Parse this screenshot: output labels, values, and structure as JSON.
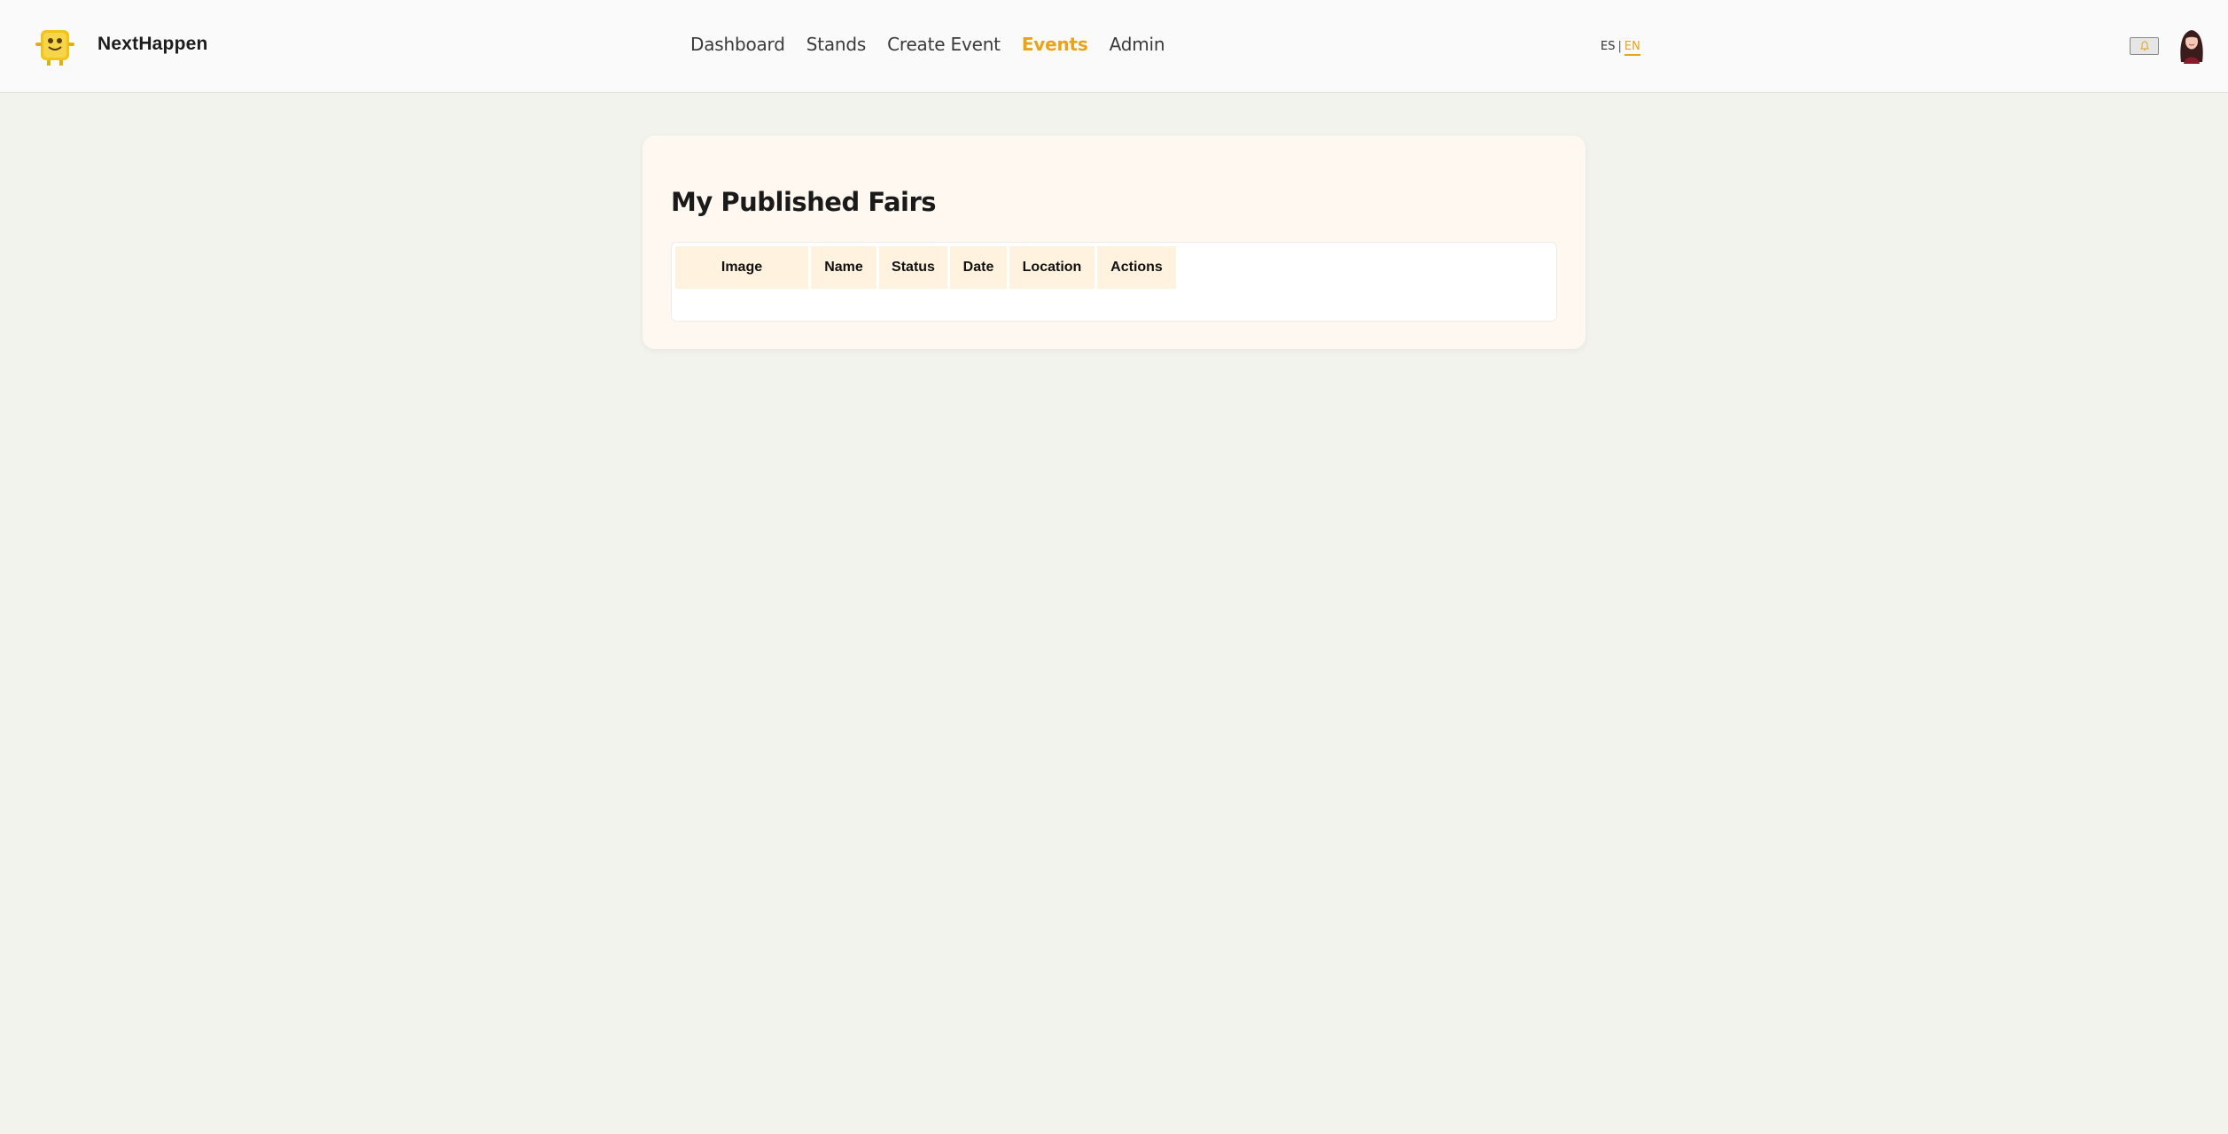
{
  "header": {
    "brand": "NextHappen",
    "logo_icon": "mascot-logo-icon",
    "nav": [
      {
        "label": "Dashboard",
        "active": false
      },
      {
        "label": "Stands",
        "active": false
      },
      {
        "label": "Create Event",
        "active": false
      },
      {
        "label": "Events",
        "active": true
      },
      {
        "label": "Admin",
        "active": false
      }
    ],
    "lang": {
      "es": "ES",
      "separator": "|",
      "en": "EN",
      "active": "EN"
    },
    "notification_icon": "bell-icon",
    "avatar_icon": "user-avatar-icon"
  },
  "main": {
    "title": "My Published Fairs",
    "table": {
      "columns": [
        "Image",
        "Name",
        "Status",
        "Date",
        "Location",
        "Actions"
      ],
      "rows": []
    }
  },
  "colors": {
    "accent": "#e8a317",
    "background": "#f3f3ee",
    "card": "#fff8f0",
    "header_cell": "#fff3e0"
  }
}
